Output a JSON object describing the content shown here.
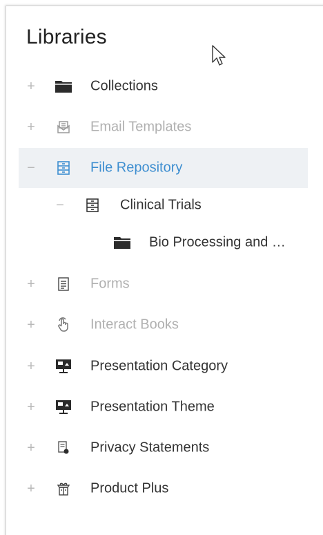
{
  "panel": {
    "title": "Libraries"
  },
  "tree": [
    {
      "label": "Collections",
      "toggle": "+",
      "icon": "folder-icon",
      "state": "normal"
    },
    {
      "label": "Email Templates",
      "toggle": "+",
      "icon": "email-template-icon",
      "state": "muted"
    },
    {
      "label": "File Repository",
      "toggle": "−",
      "icon": "file-cabinet-icon",
      "state": "selected"
    },
    {
      "label": "Clinical Trials",
      "toggle": "−",
      "icon": "file-cabinet-icon",
      "state": "normal"
    },
    {
      "label": "Bio Processing and …",
      "toggle": "",
      "icon": "folder-icon",
      "state": "normal"
    },
    {
      "label": "Forms",
      "toggle": "+",
      "icon": "form-icon",
      "state": "muted"
    },
    {
      "label": "Interact Books",
      "toggle": "+",
      "icon": "hand-pointer-icon",
      "state": "muted"
    },
    {
      "label": "Presentation Category",
      "toggle": "+",
      "icon": "presentation-icon",
      "state": "normal"
    },
    {
      "label": "Presentation Theme",
      "toggle": "+",
      "icon": "presentation-icon",
      "state": "normal"
    },
    {
      "label": "Privacy Statements",
      "toggle": "+",
      "icon": "privacy-doc-icon",
      "state": "normal"
    },
    {
      "label": "Product Plus",
      "toggle": "+",
      "icon": "product-box-icon",
      "state": "normal"
    }
  ],
  "colors": {
    "text": "#333333",
    "muted": "#b0b0b0",
    "active": "#3d8ed0",
    "selected_bg": "#eef1f4",
    "icon_dark": "#2b2b2b"
  }
}
